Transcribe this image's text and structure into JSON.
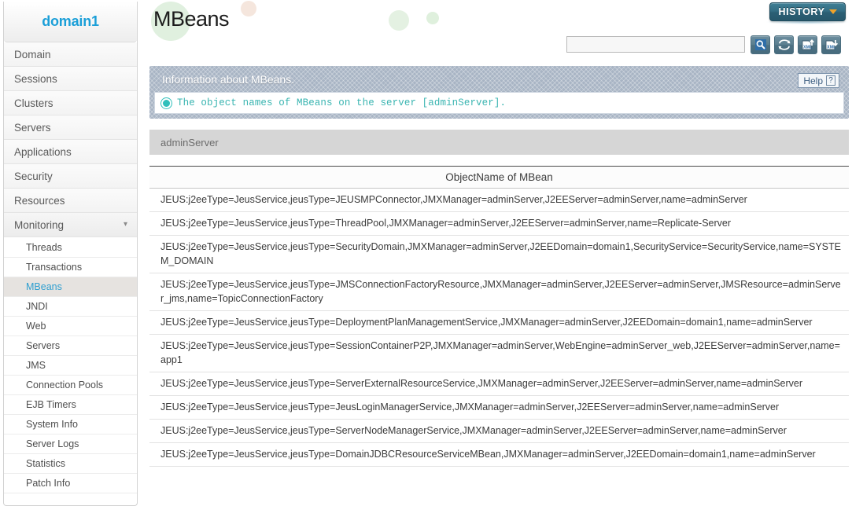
{
  "sidebar": {
    "domain_label": "domain1",
    "accent_color": "#1b9fd8",
    "top_items": [
      {
        "label": "Domain",
        "expandable": false
      },
      {
        "label": "Sessions",
        "expandable": false
      },
      {
        "label": "Clusters",
        "expandable": false
      },
      {
        "label": "Servers",
        "expandable": false
      },
      {
        "label": "Applications",
        "expandable": false
      },
      {
        "label": "Security",
        "expandable": false
      },
      {
        "label": "Resources",
        "expandable": false
      },
      {
        "label": "Monitoring",
        "expandable": true,
        "chevron": "chevron-down-icon"
      }
    ],
    "sub_items": [
      {
        "label": "Threads",
        "active": false
      },
      {
        "label": "Transactions",
        "active": false
      },
      {
        "label": "MBeans",
        "active": true
      },
      {
        "label": "JNDI",
        "active": false
      },
      {
        "label": "Web",
        "active": false
      },
      {
        "label": "Servers",
        "active": false
      },
      {
        "label": "JMS",
        "active": false
      },
      {
        "label": "Connection Pools",
        "active": false
      },
      {
        "label": "EJB Timers",
        "active": false
      },
      {
        "label": "System Info",
        "active": false
      },
      {
        "label": "Server Logs",
        "active": false
      },
      {
        "label": "Statistics",
        "active": false
      },
      {
        "label": "Patch Info",
        "active": false
      }
    ]
  },
  "header": {
    "page_title": "MBeans",
    "history_button": {
      "label": "HISTORY",
      "caret_icon": "chevron-down-icon",
      "caret_color": "#f0a32a",
      "bg_color": "#2b5f74"
    }
  },
  "toolbar": {
    "search_value": "",
    "search_placeholder": "",
    "buttons": [
      {
        "icon": "search-icon",
        "title": "Search"
      },
      {
        "icon": "refresh-icon",
        "title": "Refresh"
      },
      {
        "icon": "xml-upload-icon",
        "title": "Import XML"
      },
      {
        "icon": "xml-download-icon",
        "title": "Export XML"
      }
    ]
  },
  "info_panel": {
    "title": "Information about MBeans.",
    "help_label": "Help",
    "help_icon": "question-mark-icon",
    "message_icon": "info-icon",
    "message": "The object names of MBeans on the server [adminServer].",
    "message_color": "#3ab5b1"
  },
  "server_bar": {
    "label": "adminServer"
  },
  "table": {
    "column_header": "ObjectName of MBean",
    "rows": [
      "JEUS:j2eeType=JeusService,jeusType=JEUSMPConnector,JMXManager=adminServer,J2EEServer=adminServer,name=adminServer",
      "JEUS:j2eeType=JeusService,jeusType=ThreadPool,JMXManager=adminServer,J2EEServer=adminServer,name=Replicate-Server",
      "JEUS:j2eeType=JeusService,jeusType=SecurityDomain,JMXManager=adminServer,J2EEDomain=domain1,SecurityService=SecurityService,name=SYSTEM_DOMAIN",
      "JEUS:j2eeType=JeusService,jeusType=JMSConnectionFactoryResource,JMXManager=adminServer,J2EEServer=adminServer,JMSResource=adminServer_jms,name=TopicConnectionFactory",
      "JEUS:j2eeType=JeusService,jeusType=DeploymentPlanManagementService,JMXManager=adminServer,J2EEDomain=domain1,name=adminServer",
      "JEUS:j2eeType=JeusService,jeusType=SessionContainerP2P,JMXManager=adminServer,WebEngine=adminServer_web,J2EEServer=adminServer,name=app1",
      "JEUS:j2eeType=JeusService,jeusType=ServerExternalResourceService,JMXManager=adminServer,J2EEServer=adminServer,name=adminServer",
      "JEUS:j2eeType=JeusService,jeusType=JeusLoginManagerService,JMXManager=adminServer,J2EEServer=adminServer,name=adminServer",
      "JEUS:j2eeType=JeusService,jeusType=ServerNodeManagerService,JMXManager=adminServer,J2EEServer=adminServer,name=adminServer",
      "JEUS:j2eeType=JeusService,jeusType=DomainJDBCResourceServiceMBean,JMXManager=adminServer,J2EEDomain=domain1,name=adminServer"
    ]
  }
}
